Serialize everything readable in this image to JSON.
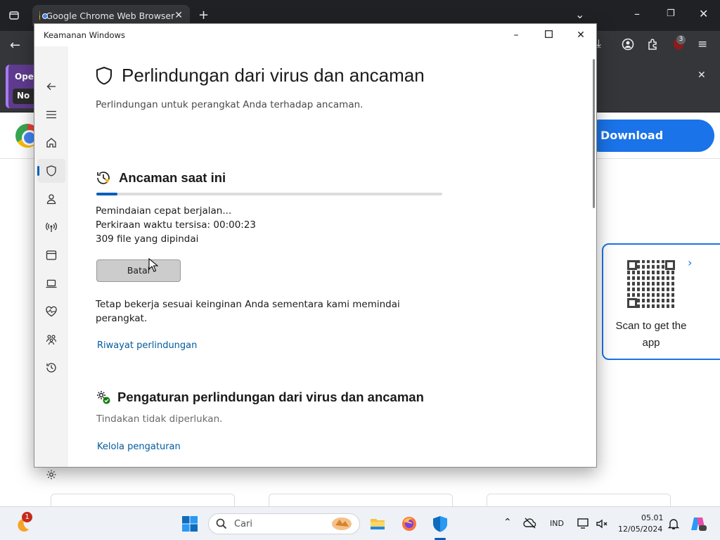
{
  "browser": {
    "tab_title": "Google Chrome Web Browser",
    "infobar_text_1": "Oper",
    "infobar_text_2": "No",
    "download_button": "Download Chrome",
    "extension_badge": "3",
    "qr_card_text": "Scan to get the app"
  },
  "window": {
    "title": "Keamanan Windows"
  },
  "nav": {
    "items": [
      "back",
      "menu",
      "home",
      "virus-protection",
      "account",
      "firewall",
      "app-browser",
      "device-security",
      "device-health",
      "family",
      "history",
      "settings"
    ]
  },
  "main": {
    "page_title": "Perlindungan dari virus dan ancaman",
    "page_subtitle": "Perlindungan untuk perangkat Anda terhadap ancaman.",
    "current_threats": {
      "title": "Ancaman saat ini",
      "progress_fraction": 0.06,
      "scan_status": "Pemindaian cepat berjalan...",
      "time_label": "Perkiraan waktu tersisa:",
      "time_value": "00:00:23",
      "files_scanned": "309 file yang dipindai",
      "cancel_button": "Batal",
      "info_text": "Tetap bekerja sesuai keinginan Anda sementara kami memindai perangkat.",
      "history_link": "Riwayat perlindungan"
    },
    "settings": {
      "title": "Pengaturan perlindungan dari virus dan ancaman",
      "status": "Tindakan tidak diperlukan.",
      "manage_link": "Kelola pengaturan"
    }
  },
  "taskbar": {
    "start_badge": "1",
    "search_placeholder": "Cari",
    "language": "IND",
    "time": "05.01",
    "date": "12/05/2024"
  },
  "colors": {
    "accent": "#005fb8",
    "link": "#005a9e",
    "chrome_blue": "#1a73e8"
  }
}
